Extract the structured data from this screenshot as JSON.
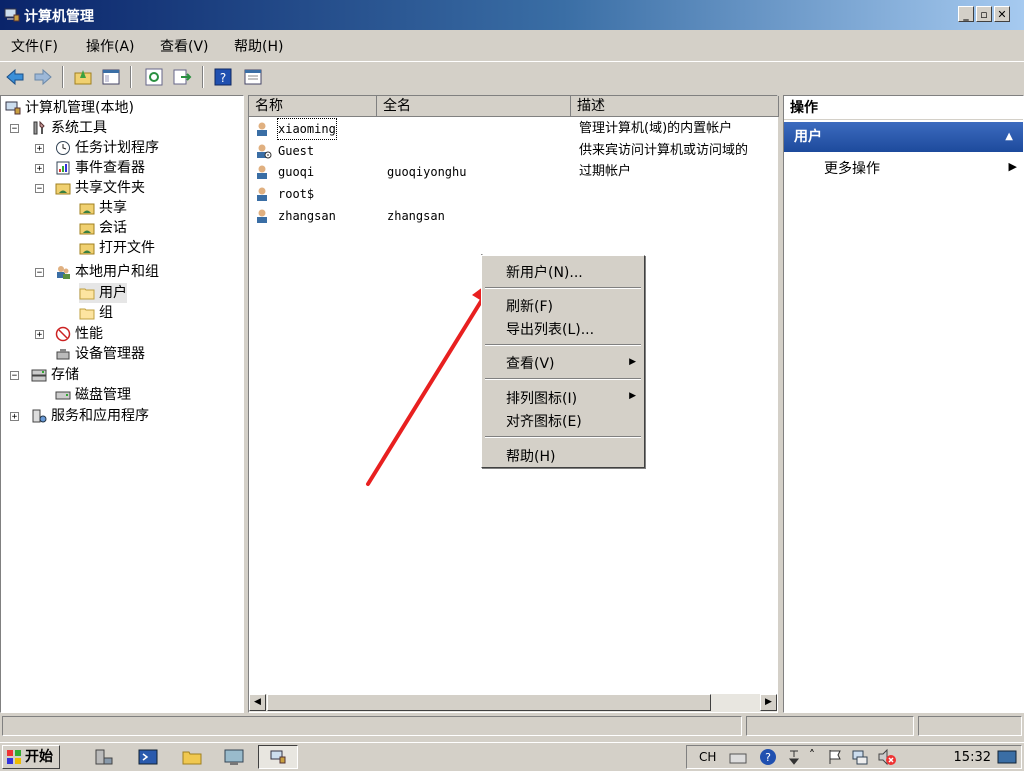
{
  "window": {
    "title": "计算机管理"
  },
  "menubar": [
    "文件(F)",
    "操作(A)",
    "查看(V)",
    "帮助(H)"
  ],
  "tree": {
    "root": "计算机管理(本地)",
    "system_tools": "系统工具",
    "task_scheduler": "任务计划程序",
    "event_viewer": "事件查看器",
    "shared_folders": "共享文件夹",
    "shares": "共享",
    "sessions": "会话",
    "open_files": "打开文件",
    "local_users_groups": "本地用户和组",
    "users": "用户",
    "groups": "组",
    "performance": "性能",
    "device_manager": "设备管理器",
    "storage": "存储",
    "disk_management": "磁盘管理",
    "services_apps": "服务和应用程序"
  },
  "list": {
    "columns": [
      "名称",
      "全名",
      "描述"
    ],
    "rows": [
      {
        "name": "xiaoming",
        "fullname": "",
        "desc": "管理计算机(域)的内置帐户"
      },
      {
        "name": "Guest",
        "fullname": "",
        "desc": "供来宾访问计算机或访问域的"
      },
      {
        "name": "guoqi",
        "fullname": "guoqiyonghu",
        "desc": "过期帐户"
      },
      {
        "name": "root$",
        "fullname": "",
        "desc": ""
      },
      {
        "name": "zhangsan",
        "fullname": "zhangsan",
        "desc": ""
      }
    ]
  },
  "actions": {
    "header": "操作",
    "section": "用户",
    "more": "更多操作"
  },
  "context_menu": {
    "new_user": "新用户(N)...",
    "refresh": "刷新(F)",
    "export": "导出列表(L)...",
    "view": "查看(V)",
    "arrange": "排列图标(I)",
    "align": "对齐图标(E)",
    "help": "帮助(H)"
  },
  "taskbar": {
    "start": "开始",
    "lang": "CH",
    "clock": "15:32"
  },
  "colors": {
    "title_start": "#0a246a",
    "action_section": "#2a5aad",
    "arrow": "#e82020"
  }
}
